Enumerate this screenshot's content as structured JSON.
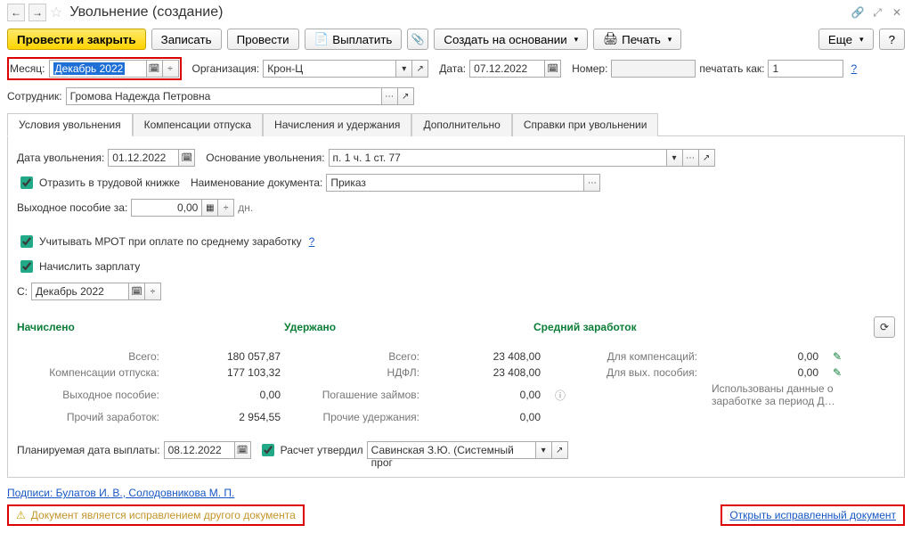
{
  "title": "Увольнение (создание)",
  "toolbar": {
    "post_close": "Провести и закрыть",
    "write": "Записать",
    "post": "Провести",
    "pay": "Выплатить",
    "create_on": "Создать на основании",
    "print": "Печать",
    "more": "Еще",
    "help": "?"
  },
  "header": {
    "month_lbl": "Месяц:",
    "month_val": "Декабрь 2022",
    "org_lbl": "Организация:",
    "org_val": "Крон-Ц",
    "date_lbl": "Дата:",
    "date_val": "07.12.2022",
    "number_lbl": "Номер:",
    "number_val": "",
    "print_as_lbl": "печатать как:",
    "print_as_val": "1",
    "help": "?",
    "emp_lbl": "Сотрудник:",
    "emp_val": "Громова Надежда Петровна"
  },
  "tabs": {
    "t1": "Условия увольнения",
    "t2": "Компенсации отпуска",
    "t3": "Начисления и удержания",
    "t4": "Дополнительно",
    "t5": "Справки при увольнении"
  },
  "cond": {
    "fire_date_lbl": "Дата увольнения:",
    "fire_date_val": "01.12.2022",
    "basis_lbl": "Основание увольнения:",
    "basis_val": "п. 1 ч. 1 ст. 77",
    "book_lbl": "Отразить в трудовой книжке",
    "docname_lbl": "Наименование документа:",
    "docname_val": "Приказ",
    "sev_lbl": "Выходное пособие за:",
    "sev_val": "0,00",
    "sev_unit": "дн.",
    "mrot_lbl": "Учитывать МРОТ при оплате по среднему заработку",
    "mrot_help": "?",
    "calc_sal_lbl": "Начислить зарплату",
    "since_lbl": "С:",
    "since_val": "Декабрь 2022"
  },
  "totals": {
    "accrued_hdr": "Начислено",
    "withheld_hdr": "Удержано",
    "avg_hdr": "Средний заработок",
    "total_lbl": "Всего:",
    "accrued_total": "180 057,87",
    "comp_lbl": "Компенсации отпуска:",
    "comp_val": "177 103,32",
    "sev_lbl": "Выходное пособие:",
    "sev_val": "0,00",
    "other_lbl": "Прочий заработок:",
    "other_val": "2 954,55",
    "withheld_total": "23 408,00",
    "ndfl_lbl": "НДФЛ:",
    "ndfl_val": "23 408,00",
    "loan_lbl": "Погашение займов:",
    "loan_val": "0,00",
    "other_with_lbl": "Прочие удержания:",
    "other_with_val": "0,00",
    "for_comp_lbl": "Для компенсаций:",
    "for_comp_val": "0,00",
    "for_sev_lbl": "Для вых. пособия:",
    "for_sev_val": "0,00",
    "info_txt": "Использованы данные о заработке за период Д…"
  },
  "footer": {
    "plan_date_lbl": "Планируемая дата выплаты:",
    "plan_date_val": "08.12.2022",
    "approved_lbl": "Расчет утвердил",
    "approved_val": "Савинская З.Ю. (Системный прог",
    "signatures": "Подписи: Булатов И. В., Солодовникова М. П.",
    "warning": "Документ является исправлением другого документа",
    "open_corr": "Открыть исправленный документ"
  }
}
